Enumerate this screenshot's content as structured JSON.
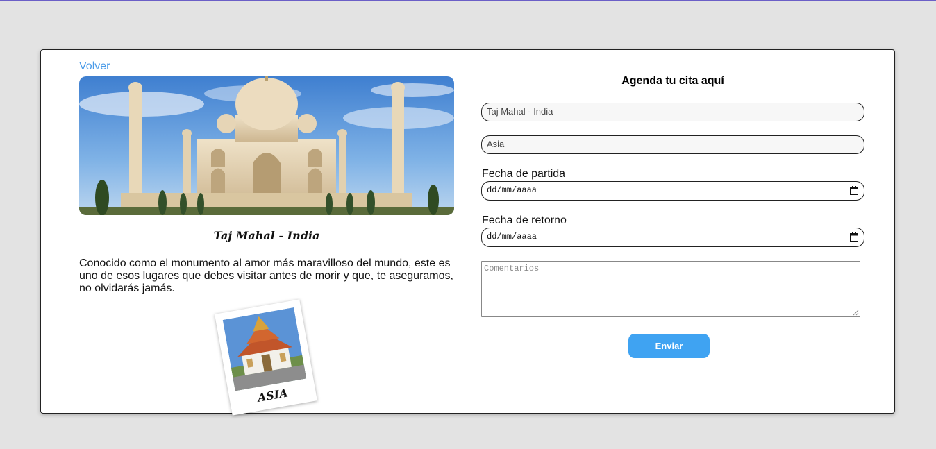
{
  "nav": {
    "back_label": "Volver"
  },
  "destination": {
    "title": "Taj Mahal - India",
    "description": "Conocido como el monumento al amor más maravilloso del mundo, este es uno de esos lugares que debes visitar antes de morir y que, te aseguramos, no olvidarás jamás.",
    "region_card_label": "ASIA"
  },
  "form": {
    "title": "Agenda tu cita aquí",
    "destination_value": "Taj Mahal -  India",
    "region_value": "Asia",
    "departure_label": "Fecha de partida",
    "departure_placeholder": "dd/mm/aaaa",
    "return_label": "Fecha de retorno",
    "return_placeholder": "dd/mm/aaaa",
    "comments_placeholder": "Comentarios",
    "submit_label": "Enviar"
  },
  "colors": {
    "accent": "#3fa3f2",
    "link": "#4a9be8",
    "background": "#e3e3e3"
  }
}
